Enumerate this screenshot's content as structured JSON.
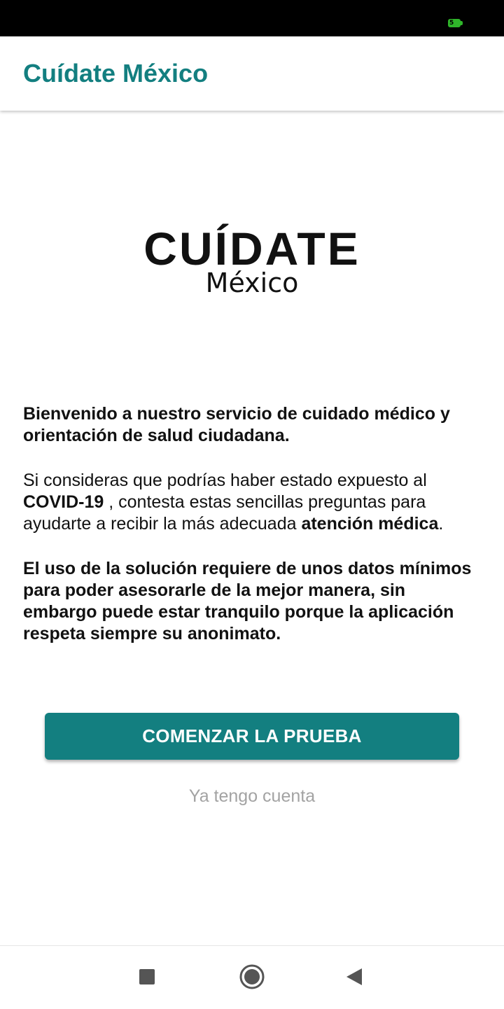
{
  "status_bar": {
    "battery_level": "5",
    "battery_icon": "battery-icon",
    "battery_color": "#2fb52a"
  },
  "app_bar": {
    "title": "Cuídate México"
  },
  "logo": {
    "wordmark": "CUÍDATE",
    "subtitle": "México"
  },
  "content": {
    "welcome": "Bienvenido a nuestro servicio de cuidado médico y orientación de salud ciudadana.",
    "info": {
      "part1": "Si consideras que podrías haber estado expuesto al ",
      "covid": "COVID-19",
      "part2": " , contesta estas sencillas preguntas para ayudarte a recibir la más adecuada ",
      "atencion": "atención médica",
      "part3": "."
    },
    "privacy": "El uso de la solución requiere de unos datos mínimos para poder asesorarle de la mejor manera, sin embargo puede estar tranquilo porque la aplicación respeta siempre su anonimato."
  },
  "actions": {
    "start_label": "COMENZAR LA PRUEBA",
    "account_label": "Ya tengo cuenta"
  },
  "nav": {
    "recents_icon": "square-icon",
    "home_icon": "circle-icon",
    "back_icon": "triangle-back-icon"
  },
  "colors": {
    "primary": "#137f80",
    "muted_text": "#a3a3a3"
  }
}
